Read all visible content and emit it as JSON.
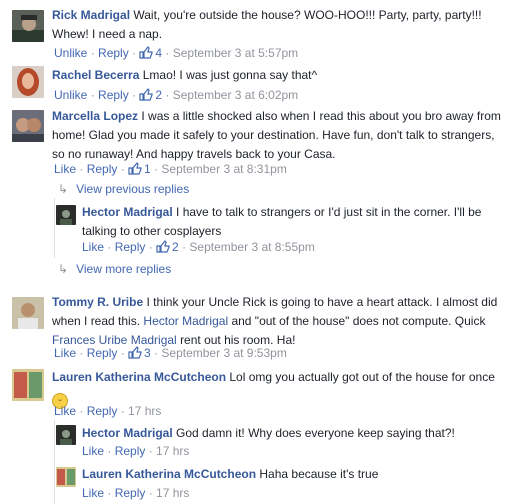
{
  "comments": [
    {
      "name": "Rick Madrigal",
      "text": "Wait, you're outside the house? WOO-HOO!!! Party, party, party!!! Whew! I need a nap.",
      "like": "Unlike",
      "reply": "Reply",
      "likes": "4",
      "time": "September 3 at 5:57pm"
    },
    {
      "name": "Rachel Becerra",
      "text": "Lmao! I was just gonna say that^",
      "like": "Unlike",
      "reply": "Reply",
      "likes": "2",
      "time": "September 3 at 6:02pm"
    },
    {
      "name": "Marcella Lopez",
      "text": "I was a little shocked also when I read this about you bro away from home! Glad you made it safely to your destination. Have fun, don't talk to strangers, so no runaway! And happy travels back to your Casa.",
      "like": "Like",
      "reply": "Reply",
      "likes": "1",
      "time": "September 3 at 8:31pm"
    },
    {
      "name": "Hector Madrigal",
      "text": "I have to talk to strangers or I'd just sit in the corner. I'll be talking to other cosplayers",
      "like": "Like",
      "reply": "Reply",
      "likes": "2",
      "time": "September 3 at 8:55pm"
    },
    {
      "name": "Tommy R. Uribe",
      "text_before": "I think your Uncle Rick is going to have a heart attack. I almost did when I read this.",
      "tag1": "Hector Madrigal",
      "text_mid": "and \"out of the house\" does not compute. Quick",
      "tag2": "Frances Uribe Madrigal",
      "text_after": "rent out his room. Ha!",
      "like": "Like",
      "reply": "Reply",
      "likes": "3",
      "time": "September 3 at 9:53pm"
    },
    {
      "name": "Lauren Katherina McCutcheon",
      "text": "Lol omg you actually got out of the house for once",
      "like": "Like",
      "reply": "Reply",
      "time": "17 hrs"
    },
    {
      "name": "Hector Madrigal",
      "text": "God damn it! Why does everyone keep saying that?!",
      "like": "Like",
      "reply": "Reply",
      "time": "17 hrs"
    },
    {
      "name": "Lauren Katherina McCutcheon",
      "text": "Haha because it's true",
      "like": "Like",
      "reply": "Reply",
      "time": "17 hrs"
    }
  ],
  "toggles": {
    "previous": "View previous replies",
    "more": "View more replies"
  },
  "separator": " · "
}
